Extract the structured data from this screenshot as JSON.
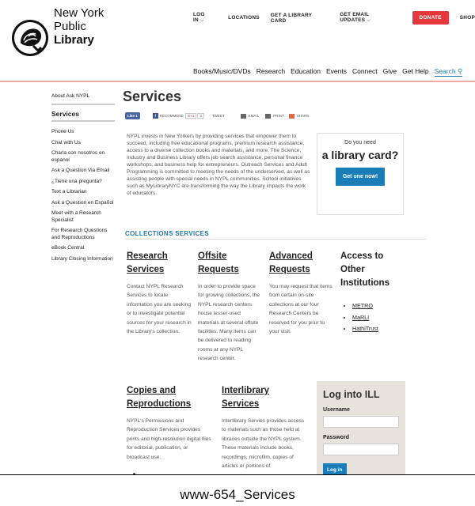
{
  "brand": {
    "line1": "New York",
    "line2": "Public",
    "line3": "Library"
  },
  "util_nav": {
    "login": "LOG IN",
    "locations": "LOCATIONS",
    "get_card": "GET A LIBRARY CARD",
    "email": "GET EMAIL UPDATES",
    "donate": "DONATE",
    "shop": "SHOP"
  },
  "main_nav": [
    "Books/Music/DVDs",
    "Research",
    "Education",
    "Events",
    "Connect",
    "Give",
    "Get Help",
    "Search"
  ],
  "sidebar": {
    "about": "About Ask NYPL",
    "services": "Services",
    "items": [
      "Phone Us",
      "Chat with Us",
      "Charla con nosotros en espanol",
      "Ask a Question Via Email",
      "¿Tiene una pregunta?",
      "Text a Librarian",
      "Ask a Question en Español",
      "Meet with a Research Specialist",
      "For Research Questions and Reproductions",
      "eBook Central",
      "Library Closing Information"
    ]
  },
  "page_title": "Services",
  "social": {
    "like": "Like 1",
    "recommend": "RECOMMEND",
    "gplus": "G+1",
    "count": "3",
    "tweet": "TWEET",
    "email": "EMAIL",
    "print": "PRINT",
    "share": "SHARE"
  },
  "intro": "NYPL invests in New Yorkers by providing services that empower them to succeed, including free educational programs, premium research assistance, access to a diverse collection books and materials, and more. The Science, Industry and Business Library offers job search assistance, personal finance workshops, and business help for entrepreneurs. Outreach Services and Adult Programming is committed to meeting the needs of the underserved, as well as assisting people with special needs in NYPL communities. School initiatives such as MyLibraryNYC are transforming the way the Library impacts the work of educators.",
  "card_box": {
    "line1": "Do you need",
    "line2": "a library card?",
    "button": "Get one now!"
  },
  "collections_heading": "COLLECTIONS SERVICES",
  "columns": [
    {
      "title": "Research Services",
      "text": "Contact NYPL Research Services to locate information you are seeking or to investigate potential sources for your research in the Library's collection."
    },
    {
      "title": "Offsite Requests",
      "text": "In order to provide space for growing collections, the NYPL research centers house lesser-used materials at several offsite facilities. Many items can be delivered to reading rooms at any NYPL research center."
    },
    {
      "title": "Advanced Requests",
      "text": "You may request that items from certain on-site collections at our four Research Centers be reserved for you prior to your visit."
    },
    {
      "title": "Access to Other Institutions",
      "links": [
        "METRO",
        "MaRLI",
        "HathiTrust"
      ]
    },
    {
      "title": "Copies and Reproductions",
      "text": "NYPL's Permissions and Reproduction Services provides prints and high-resolution digital files for editorial, publication, or broadcast use."
    },
    {
      "title": "Interlibrary Services",
      "text": "Interlibrary Servies provides access to materials such as those held at libraries outside the NYPL system. These materials include books, recordings, microfilm, copies of articles or portions of"
    }
  ],
  "ill": {
    "title": "Log into ILL",
    "username": "Username",
    "password": "Password",
    "button": "Log in"
  },
  "caption": "www-654_Services"
}
